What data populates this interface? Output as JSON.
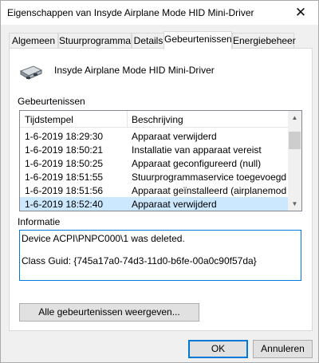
{
  "window": {
    "title": "Eigenschappen van Insyde Airplane Mode HID Mini-Driver",
    "close_glyph": "✕"
  },
  "tabs": [
    {
      "label": "Algemeen",
      "active": false
    },
    {
      "label": "Stuurprogramma",
      "active": false
    },
    {
      "label": "Details",
      "active": false
    },
    {
      "label": "Gebeurtenissen",
      "active": true
    },
    {
      "label": "Energiebeheer",
      "active": false
    }
  ],
  "device": {
    "name": "Insyde Airplane Mode HID Mini-Driver",
    "icon": "device-icon"
  },
  "events": {
    "section_label": "Gebeurtenissen",
    "columns": [
      "Tijdstempel",
      "Beschrijving"
    ],
    "rows": [
      {
        "timestamp": "1-6-2019 18:29:30",
        "description": "Apparaat verwijderd",
        "selected": false
      },
      {
        "timestamp": "1-6-2019 18:50:21",
        "description": "Installatie van apparaat vereist",
        "selected": false
      },
      {
        "timestamp": "1-6-2019 18:50:25",
        "description": "Apparaat geconfigureerd (null)",
        "selected": false
      },
      {
        "timestamp": "1-6-2019 18:51:55",
        "description": "Stuurprogrammaservice toegevoegd (...",
        "selected": false
      },
      {
        "timestamp": "1-6-2019 18:51:56",
        "description": "Apparaat geïnstalleerd (airplanemode...",
        "selected": false
      },
      {
        "timestamp": "1-6-2019 18:52:40",
        "description": "Apparaat verwijderd",
        "selected": true
      }
    ]
  },
  "info": {
    "section_label": "Informatie",
    "text": "Device ACPI\\PNPC000\\1 was deleted.\n\nClass Guid: {745a17a0-74d3-11d0-b6fe-00a0c90f57da}"
  },
  "buttons": {
    "show_all": "Alle gebeurtenissen weergeven...",
    "ok": "OK",
    "cancel": "Annuleren"
  },
  "colors": {
    "selection": "#cce8ff",
    "focus_border": "#0078d7"
  }
}
